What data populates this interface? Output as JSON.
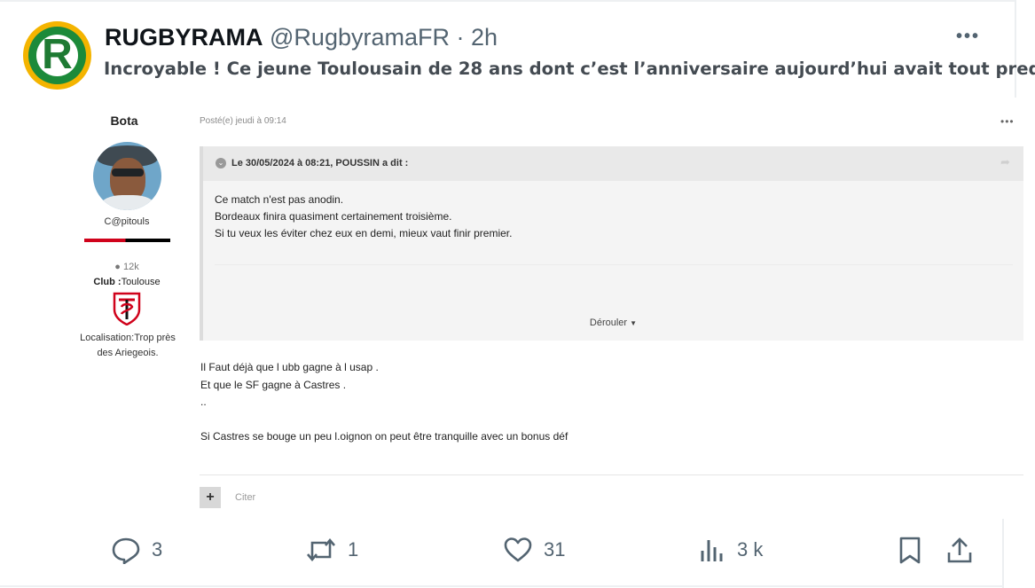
{
  "tweet": {
    "author_name": "RUGBYRAMA",
    "author_meta": "@RugbyramaFR · 2h",
    "avatar_letter": "R",
    "text": "Incroyable ! Ce jeune Toulousain de 28 ans dont c’est l’anniversaire aujourd’hui avait tout predit !",
    "more_icon": "more-horizontal-icon"
  },
  "forum": {
    "username": "Bota",
    "user_title": "C@pitouls",
    "stats": "12k",
    "club_label": "Club :",
    "club_value": "Toulouse",
    "location_line1": "Localisation:Trop près",
    "location_line2": "des Ariegeois.",
    "post_date": "Posté(e) jeudi à 09:14",
    "menu": "•••",
    "quote": {
      "citation": "Le 30/05/2024 à 08:21, POUSSIN a dit :",
      "lines": [
        "Ce match n'est pas anodin.",
        "Bordeaux finira quasiment certainement troisième.",
        "Si tu veux les éviter chez eux en demi, mieux vaut finir premier."
      ],
      "expand_label": "Dérouler"
    },
    "body_lines": [
      "Il Faut déjà que l ubb gagne à l usap .",
      "Et que le SF gagne à Castres .",
      "..",
      "",
      "Si Castres se bouge un peu l.oignon on peut être tranquille avec un bonus déf"
    ],
    "cite_label": "Citer",
    "plus_label": "+"
  },
  "actions": {
    "reply_count": "3",
    "retweet_count": "1",
    "like_count": "31",
    "views_count": "3 k"
  },
  "colors": {
    "text_primary": "#0f1419",
    "text_secondary": "#536471",
    "club_red": "#d0021b",
    "brand_green": "#1e7a33",
    "brand_yellow": "#f4b400"
  }
}
